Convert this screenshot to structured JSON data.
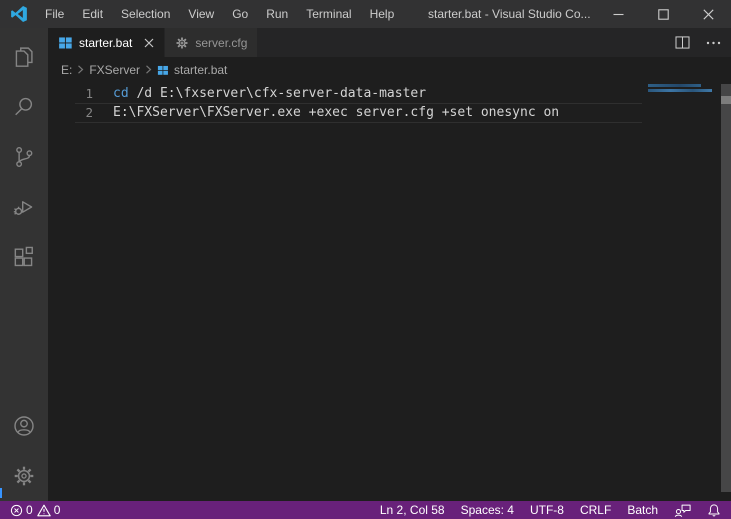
{
  "window": {
    "title": "starter.bat - Visual Studio Co..."
  },
  "menu_bar": {
    "items": [
      "File",
      "Edit",
      "Selection",
      "View",
      "Go",
      "Run",
      "Terminal",
      "Help"
    ]
  },
  "tabs": {
    "active": {
      "label": "starter.bat",
      "icon": "windows-bat-icon"
    },
    "inactive": {
      "label": "server.cfg",
      "icon": "gear-icon"
    }
  },
  "breadcrumb": {
    "drive": "E:",
    "folder": "FXServer",
    "file": "starter.bat",
    "file_icon": "windows-bat-icon"
  },
  "editor": {
    "lines": [
      {
        "number": "1",
        "keyword": "cd",
        "rest": " /d E:\\fxserver\\cfx-server-data-master"
      },
      {
        "number": "2",
        "keyword": "",
        "rest": "E:\\FXServer\\FXServer.exe +exec server.cfg +set onesync on"
      }
    ]
  },
  "status_bar": {
    "errors": "0",
    "warnings": "0",
    "cursor_position": "Ln 2, Col 58",
    "indentation": "Spaces: 4",
    "encoding": "UTF-8",
    "eol": "CRLF",
    "language": "Batch"
  },
  "colors": {
    "status_bar_bg": "#68217A",
    "keyword_blue": "#569CD6",
    "bat_icon_blue": "#47A7E8",
    "logo_blue": "#2FA8E0",
    "editor_bg": "#1E1E1E",
    "activity_bar_bg": "#333333",
    "title_bar_bg": "#323233"
  }
}
